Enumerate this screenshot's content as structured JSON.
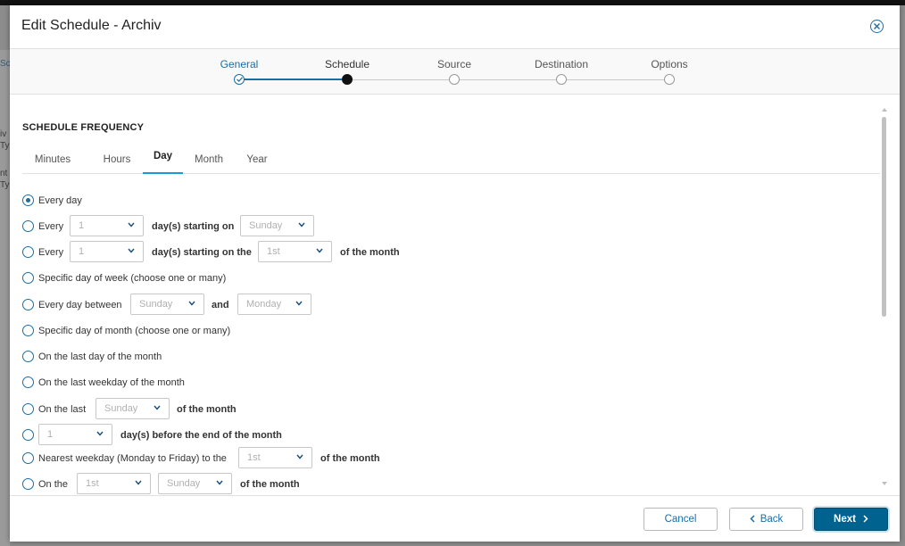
{
  "background": {
    "fragments": [
      "Sc",
      "iv",
      "Ty",
      "nt",
      "Ty"
    ]
  },
  "dialog": {
    "title": "Edit Schedule - Archiv"
  },
  "wizard": {
    "steps": [
      {
        "label": "General",
        "state": "done"
      },
      {
        "label": "Schedule",
        "state": "active"
      },
      {
        "label": "Source",
        "state": "pending"
      },
      {
        "label": "Destination",
        "state": "pending"
      },
      {
        "label": "Options",
        "state": "pending"
      }
    ]
  },
  "schedule": {
    "section_title": "SCHEDULE FREQUENCY",
    "tabs": [
      "Minutes",
      "Hours",
      "Day",
      "Month",
      "Year"
    ],
    "active_tab": "Day",
    "options": {
      "every_day": {
        "label": "Every day",
        "checked": true
      },
      "every_n_days_weekday": {
        "prefix": "Every",
        "count": "1",
        "mid": "day(s) starting on",
        "weekday": "Sunday"
      },
      "every_n_days_monthday": {
        "prefix": "Every",
        "count": "1",
        "mid": "day(s) starting on the",
        "monthday": "1st",
        "suffix": "of the month"
      },
      "specific_weekday": {
        "label": "Specific day of week (choose one or many)"
      },
      "between": {
        "prefix": "Every day between",
        "from": "Sunday",
        "and": "and",
        "to": "Monday"
      },
      "specific_monthday": {
        "label": "Specific day of month (choose one or many)"
      },
      "last_day": {
        "label": "On the last day of the month"
      },
      "last_weekday": {
        "label": "On the last weekday of the month"
      },
      "last_named_day": {
        "prefix": "On the last",
        "weekday": "Sunday",
        "suffix": "of the month"
      },
      "days_before_end": {
        "count": "1",
        "suffix": "day(s) before the end of the month"
      },
      "nearest_weekday": {
        "prefix": "Nearest weekday (Monday to Friday) to the",
        "monthday": "1st",
        "suffix": "of the month"
      },
      "on_the": {
        "prefix": "On the",
        "ordinal": "1st",
        "weekday": "Sunday",
        "suffix": "of the month"
      }
    }
  },
  "footer": {
    "cancel": "Cancel",
    "back": "Back",
    "next": "Next"
  },
  "colors": {
    "accent": "#1a6da6",
    "primary_button": "#00628f",
    "tab_underline": "#1a9bd7"
  }
}
